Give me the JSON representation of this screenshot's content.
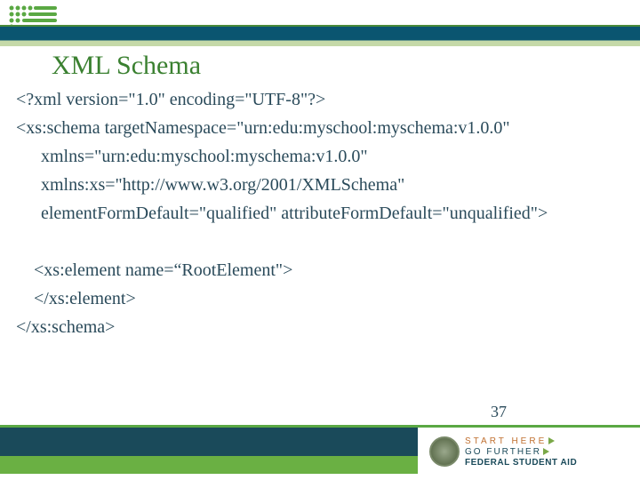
{
  "title": "XML Schema",
  "code": {
    "l1": "<?xml version=\"1.0\" encoding=\"UTF-8\"?>",
    "l2": "<xs:schema targetNamespace=\"urn:edu:myschool:myschema:v1.0.0\"",
    "l3": "xmlns=\"urn:edu:myschool:myschema:v1.0.0\"",
    "l4": "xmlns:xs=\"http://www.w3.org/2001/XMLSchema\"",
    "l5": "elementFormDefault=\"qualified\" attributeFormDefault=\"unqualified\">",
    "l6": "<xs:element name=“RootElement\">",
    "l7": "</xs:element>",
    "l8": "</xs:schema>"
  },
  "pageNumber": "37",
  "footerLogo": {
    "line1": "START HERE",
    "line2": "GO FURTHER",
    "line3": "FEDERAL STUDENT AID"
  }
}
